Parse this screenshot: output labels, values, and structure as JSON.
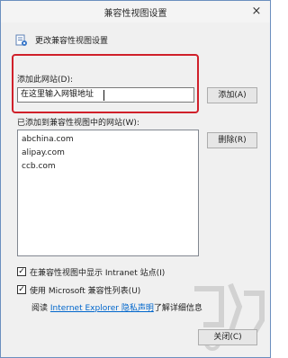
{
  "window": {
    "title": "兼容性视图设置",
    "close_glyph": "×"
  },
  "header": {
    "icon": "settings-doc-icon",
    "text": "更改兼容性视图设置"
  },
  "add_section": {
    "label": "添加此网站(D):",
    "input_value": "在这里输入网银地址",
    "add_button": "添加(A)",
    "highlight_color": "#d0202a"
  },
  "list_section": {
    "label": "已添加到兼容性视图中的网站(W):",
    "sites": [
      "abchina.com",
      "alipay.com",
      "ccb.com"
    ],
    "remove_button": "删除(R)"
  },
  "options": [
    {
      "label": "在兼容性视图中显示 Intranet 站点(I)",
      "checked": true,
      "check_glyph": "✓"
    },
    {
      "label": "使用 Microsoft 兼容性列表(U)",
      "checked": true,
      "check_glyph": "✓"
    }
  ],
  "footer": {
    "read_prefix": "阅读",
    "link_text": "Internet Explorer 隐私声明",
    "read_suffix": "了解详细信息",
    "close_button": "关闭(C)"
  },
  "watermark": {
    "icon": "watermark-logo-icon"
  }
}
